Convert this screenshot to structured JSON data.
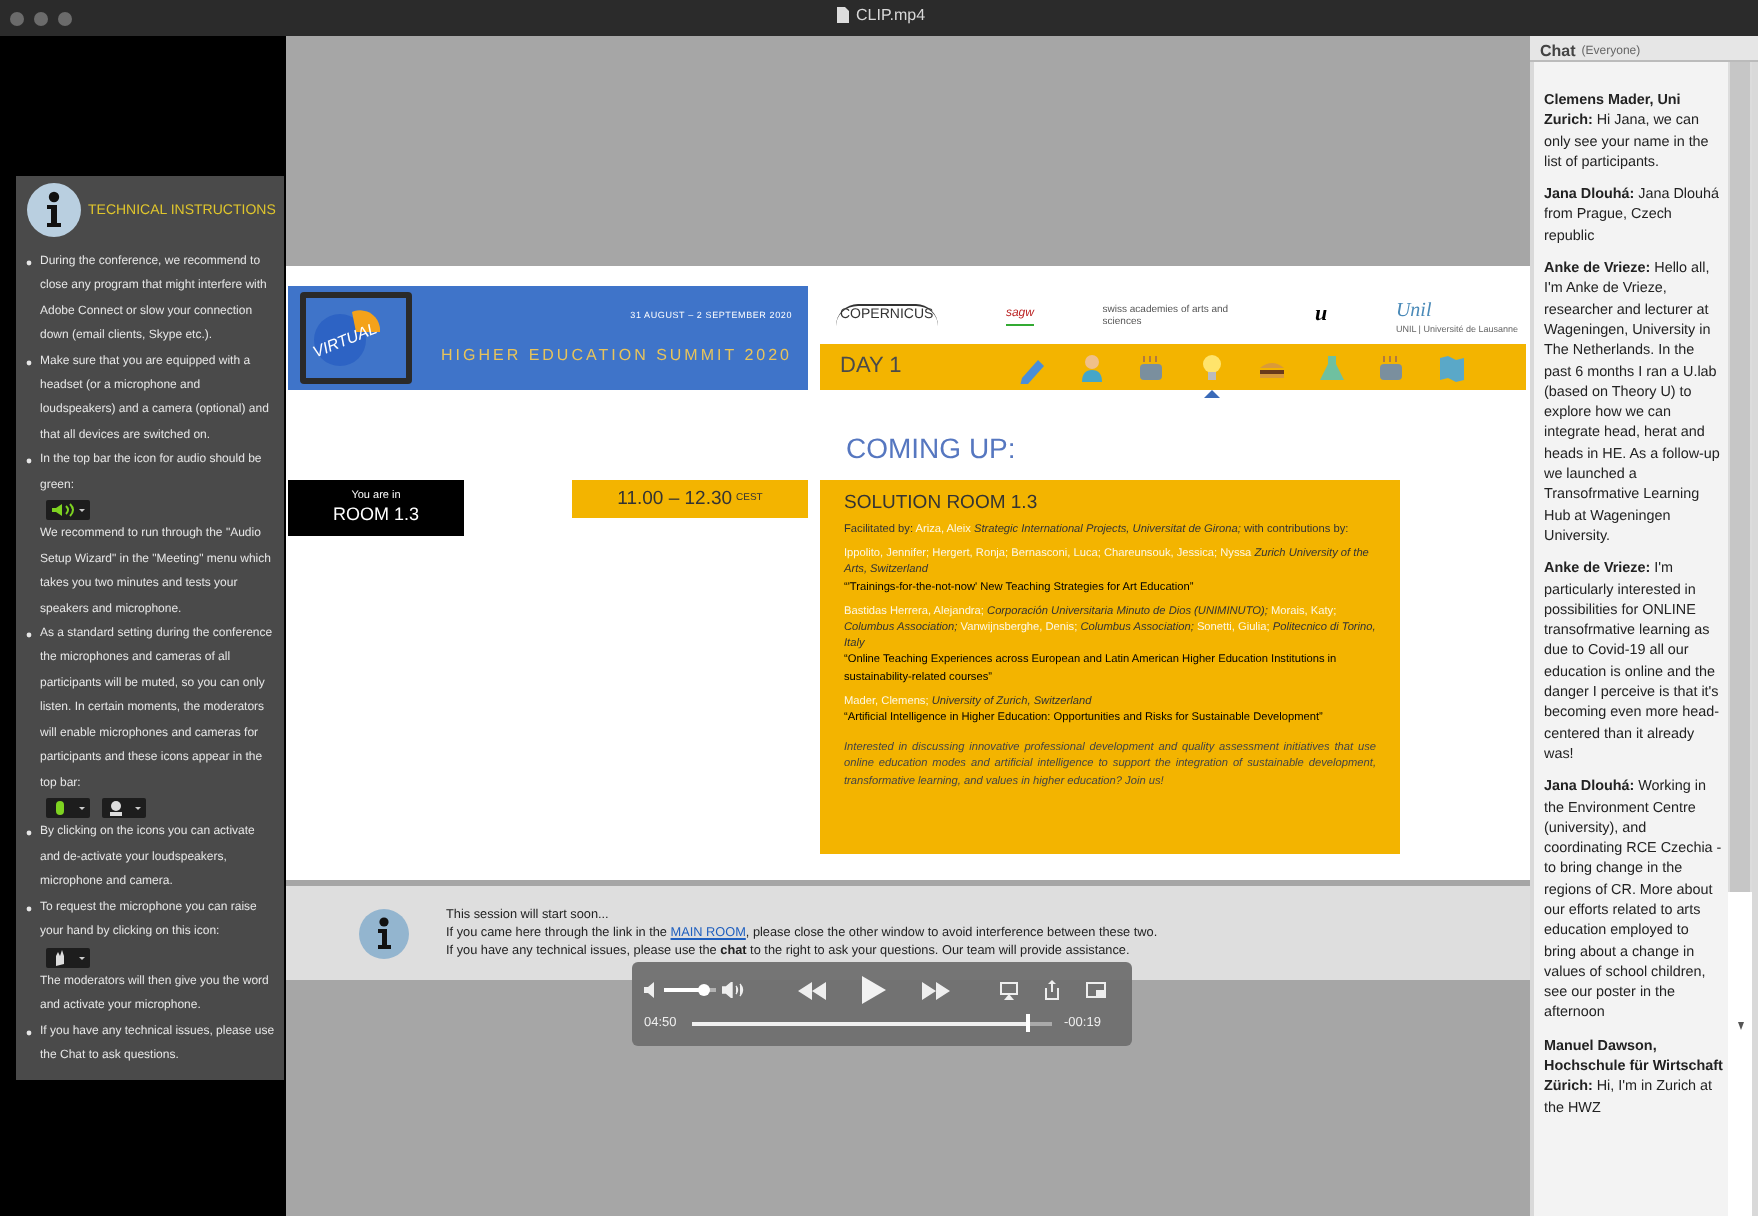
{
  "window": {
    "title": "CLIP.mp4"
  },
  "instructions": {
    "title": "TECHNICAL INSTRUCTIONS",
    "items": [
      {
        "parts": [
          {
            "kind": "text",
            "text": "During the conference, we recommend to close any program that might interfere with Adobe Connect or slow your connection down (email clients, Skype etc.)."
          }
        ]
      },
      {
        "parts": [
          {
            "kind": "text",
            "text": "Make sure that you are equipped with a headset (or a microphone and loudspeakers) and a camera (optional) and that all devices are switched on."
          }
        ]
      },
      {
        "parts": [
          {
            "kind": "text",
            "text": "In the top bar the icon for audio should be green:"
          },
          {
            "kind": "speaker_control"
          },
          {
            "kind": "line",
            "text": "We recommend to run through the \"Audio Setup Wizard\" in the \"Meeting\" menu which takes you two minutes and tests your speakers and microphone."
          }
        ]
      },
      {
        "parts": [
          {
            "kind": "text",
            "text": "As a standard setting during the conference the microphones and cameras of all participants will be muted, so you can only listen. In certain moments, the moderators will enable microphones and cameras for participants and these icons appear in the top bar:"
          },
          {
            "kind": "mic_control"
          },
          {
            "kind": "camera_control"
          }
        ]
      },
      {
        "parts": [
          {
            "kind": "text",
            "text": "By clicking on the icons you can activate and de-activate your loudspeakers, microphone and camera."
          }
        ]
      },
      {
        "parts": [
          {
            "kind": "text",
            "text": "To request the microphone you can raise your hand by clicking on this icon:"
          },
          {
            "kind": "hand_control"
          },
          {
            "kind": "text",
            "text": "The moderators will then give you the word and activate your microphone."
          }
        ]
      },
      {
        "parts": [
          {
            "kind": "text",
            "text": "If you have any technical issues, please use the Chat to ask questions."
          }
        ]
      }
    ]
  },
  "banner": {
    "dates": "31 AUGUST – 2 SEPTEMBER 2020",
    "virtual": "VIRTUAL",
    "title": "HIGHER EDUCATION SUMMIT 2020"
  },
  "logos": [
    {
      "text": "COPERNICUS"
    },
    {
      "text": "sagw"
    },
    {
      "text": "swiss academies of arts and sciences"
    },
    {
      "text": "u"
    },
    {
      "text": "Unil",
      "subtext": "UNIL | Université de Lausanne"
    }
  ],
  "day": {
    "label": "DAY 1",
    "schedule": [
      {
        "kind": "pencil",
        "selected": false
      },
      {
        "kind": "person",
        "selected": false
      },
      {
        "kind": "coffee",
        "selected": false
      },
      {
        "kind": "bulb",
        "selected": true
      },
      {
        "kind": "sandwich",
        "selected": false
      },
      {
        "kind": "flask",
        "selected": false
      },
      {
        "kind": "coffee",
        "selected": false
      },
      {
        "kind": "map",
        "selected": false
      }
    ]
  },
  "coming_up": "COMING UP:",
  "room": {
    "label": "You are in",
    "name": "ROOM 1.3"
  },
  "time": {
    "range": "11.00 – 12.30",
    "zone": "CEST"
  },
  "session": {
    "title": "SOLUTION ROOM 1.3",
    "blocks": [
      {
        "segments": [
          {
            "kind": "label",
            "text": "Facilitated by:"
          },
          {
            "kind": "name",
            "text": "Ariza, Aleix"
          },
          {
            "kind": "affiliation",
            "text": "Strategic International Projects, Universitat de Girona;"
          },
          {
            "kind": "label",
            "text": "with contributions by:"
          }
        ]
      },
      {
        "segments": [
          {
            "kind": "name",
            "text": "Ippolito, Jennifer; Hergert, Ronja; Bernasconi, Luca; Chareunsouk, Jessica; Nyssa"
          },
          {
            "kind": "affiliation",
            "text": "Zurich University of the Arts, Switzerland"
          }
        ],
        "talk": "“'Trainings-for-the-not-now' New Teaching Strategies for Art Education”"
      },
      {
        "segments": [
          {
            "kind": "name",
            "text": "Bastidas Herrera, Alejandra;"
          },
          {
            "kind": "affiliation",
            "text": "Corporación Universitaria Minuto de Dios (UNIMINUTO);"
          },
          {
            "kind": "name",
            "text": "Morais, Katy;"
          },
          {
            "kind": "affiliation",
            "text": "Columbus Association;"
          },
          {
            "kind": "name",
            "text": "Vanwijnsberghe, Denis;"
          },
          {
            "kind": "affiliation",
            "text": "Columbus Association;"
          },
          {
            "kind": "name",
            "text": "Sonetti, Giulia;"
          },
          {
            "kind": "affiliation",
            "text": "Politecnico di Torino, Italy"
          }
        ],
        "talk": "“Online Teaching Experiences across European and Latin American Higher Education Institutions in sustainability-related courses”"
      },
      {
        "segments": [
          {
            "kind": "name",
            "text": "Mader, Clemens;"
          },
          {
            "kind": "affiliation",
            "text": "University of Zurich, Switzerland"
          }
        ],
        "talk": "“Artificial Intelligence in Higher Education: Opportunities and Risks for Sustainable Development”"
      }
    ],
    "teaser": "Interested in discussing innovative professional development and quality assessment initiatives that use online education modes and artificial intelligence to support the integration of sustainable development, transformative learning, and values in higher education? Join us!"
  },
  "notice": {
    "lines": [
      {
        "text": "This session will start soon..."
      },
      {
        "text": "If you came here through the link in the",
        "link": "MAIN ROOM",
        "after": ", please close the other window to avoid interference between these two."
      },
      {
        "text": "If you have any technical issues, please use the **chat** to the right to ask your questions. Our team will provide assistance."
      }
    ]
  },
  "player": {
    "volume": {
      "level": 0.78
    },
    "position": {
      "level": 0.93
    },
    "elapsed": "04:50",
    "remaining": "-00:19"
  },
  "chat": {
    "title": "Chat",
    "scope": "(Everyone)",
    "messages": [
      {
        "author": "Clemens Mader, Uni Zurich:",
        "text": "Hi Jana, we can only see your name in the list of participants."
      },
      {
        "author": "Jana Dlouhá:",
        "text": "Jana Dlouhá from Prague, Czech republic"
      },
      {
        "author": "Anke de Vrieze:",
        "text": "Hello all, I'm Anke de Vrieze, researcher and lecturer at Wageningen, University in The Netherlands. In the past 6 months I ran a U.lab (based on Theory U) to explore how we can integrate head, herat and heads in HE. As a follow-up we launched a Transofrmative Learning Hub at Wageningen University."
      },
      {
        "author": "Anke de Vrieze:",
        "text": "I'm particularly interested in possibilities for ONLINE transofrmative learning as due to Covid-19 all our education is online and the danger I perceive is that it's becoming even more head-centered than it already was!"
      },
      {
        "author": "Jana Dlouhá:",
        "text": "Working in the Environment Centre (university), and coordinating RCE Czechia - to bring change in the regions of CR. More about our efforts related to arts education employed to bring about a change in values of school children, see our poster in the afternoon"
      },
      {
        "author": "Manuel Dawson, Hochschule für Wirtschaft Zürich:",
        "text": "Hi, I'm in Zurich at the HWZ"
      }
    ]
  }
}
